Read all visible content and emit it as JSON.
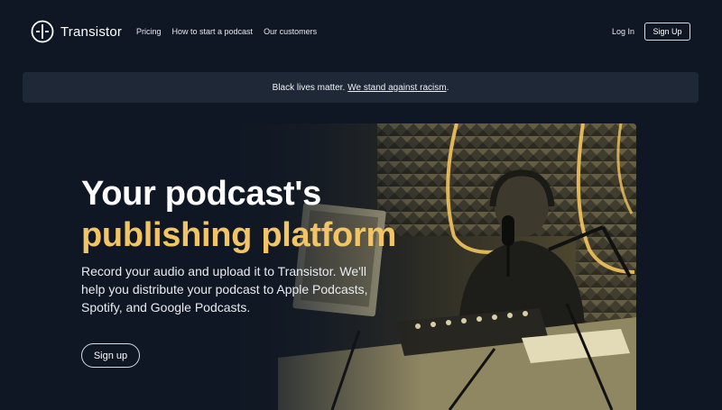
{
  "header": {
    "brand": "Transistor",
    "nav": [
      "Pricing",
      "How to start a podcast",
      "Our customers"
    ],
    "login_label": "Log In",
    "signup_label": "Sign Up"
  },
  "banner": {
    "text": "Black lives matter.",
    "link": "We stand against racism",
    "suffix": "."
  },
  "hero": {
    "title_line1": "Your podcast's",
    "title_line2": "publishing platform",
    "lede": "Record your audio and upload it to Transistor. We'll help you distribute your podcast to Apple Podcasts, Spotify, and Google Podcasts.",
    "signup_label": "Sign up"
  },
  "colors": {
    "background": "#0f1724",
    "banner": "#1e2836",
    "accent": "#f2c466"
  },
  "icons": {
    "logo": "transistor-logo-icon",
    "hero_photo": "podcast-studio-photo"
  }
}
